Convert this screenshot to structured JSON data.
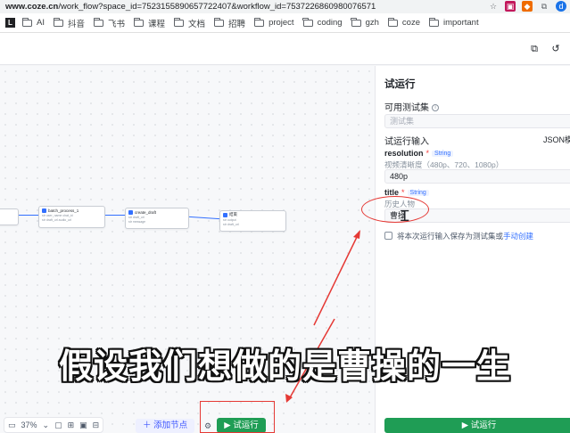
{
  "browser": {
    "url_host": "www.coze.cn",
    "url_path": "/work_flow?space_id=7523155890657722407&workflow_id=7537226860980076571",
    "bookmarks": [
      "AI",
      "抖音",
      "飞书",
      "课程",
      "文档",
      "招聘",
      "project",
      "coding",
      "gzh",
      "coze",
      "important"
    ]
  },
  "canvas": {
    "nodes": [
      {
        "title": "",
        "rows": [
          "",
          ""
        ]
      },
      {
        "title": "batch_process_1",
        "rows": [
          "str  user_name  chat_id",
          "str  draft_url  audio_url"
        ]
      },
      {
        "title": "create_draft",
        "rows": [
          "str  draft_url",
          "str  message"
        ]
      },
      {
        "title": "结束",
        "rows": [
          "str  output",
          "str  draft_url"
        ]
      }
    ],
    "zoom": "37%",
    "add_node_label": "添加节点",
    "run_label": "试运行"
  },
  "panel": {
    "title": "试运行",
    "testset_label": "可用测试集",
    "testset_placeholder": "测试集",
    "input_label": "试运行输入",
    "json_mode": "JSON模式",
    "fields": [
      {
        "name": "resolution",
        "type": "String",
        "desc": "视频清晰度（480p、720、1080p）",
        "value": "480p"
      },
      {
        "name": "title",
        "type": "String",
        "desc": "历史人物",
        "value": "曹操"
      }
    ],
    "save_prefix": "将本次运行输入保存为测试集或",
    "save_link": "手动创建",
    "run_button": "试运行"
  },
  "caption": "假设我们想做的是曹操的一生",
  "colors": {
    "accent": "#3370ff",
    "run_green": "#1f9d55",
    "annotation_red": "#e53935"
  }
}
